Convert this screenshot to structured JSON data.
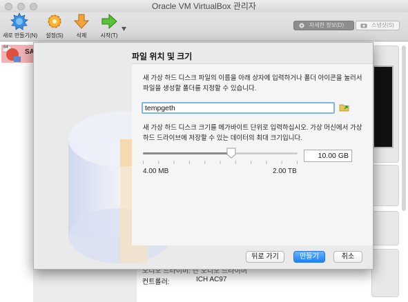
{
  "window": {
    "title": "Oracle VM VirtualBox 관리자"
  },
  "toolbar": {
    "new_label": "새로 만들기(N)",
    "settings_label": "설정(S)",
    "discard_label": "삭제",
    "start_label": "시작(T)",
    "details_label": "자세한 정보(D)",
    "snapshots_label": "스냅샷(S)"
  },
  "vm_list": {
    "items": [
      {
        "name": "SA",
        "badge": "64"
      }
    ]
  },
  "details": {
    "audio_partial": "오디오 드라이버:   단 오디오 드라이버",
    "controller_label": "컨트롤러:",
    "controller_value": "ICH AC97"
  },
  "dialog": {
    "title": "파일 위치 및 크기",
    "location_description": "새 가상 하드 디스크 파일의 이름을 아래 상자에 입력하거나 폴더 아이콘을 눌러서 파일을 생성할 폴더를 지정할 수 있습니다.",
    "filename": "tempgeth",
    "size_description": "새 가상 하드 디스크 크기를 메가바이트 단위로 입력하십시오. 가상 머신에서 가상 하드 드라이브에 저장할 수 있는 데이터의 최대 크기입니다.",
    "size_value": "10.00 GB",
    "slider_position": 0.57,
    "min_label": "4.00 MB",
    "max_label": "2.00 TB",
    "back_button": "뒤로 가기",
    "create_button": "만들기",
    "cancel_button": "취소"
  },
  "colors": {
    "accent": "#1a82fb",
    "input_focus": "#7fb3ec",
    "vm_selected": "#f2b3b3"
  }
}
